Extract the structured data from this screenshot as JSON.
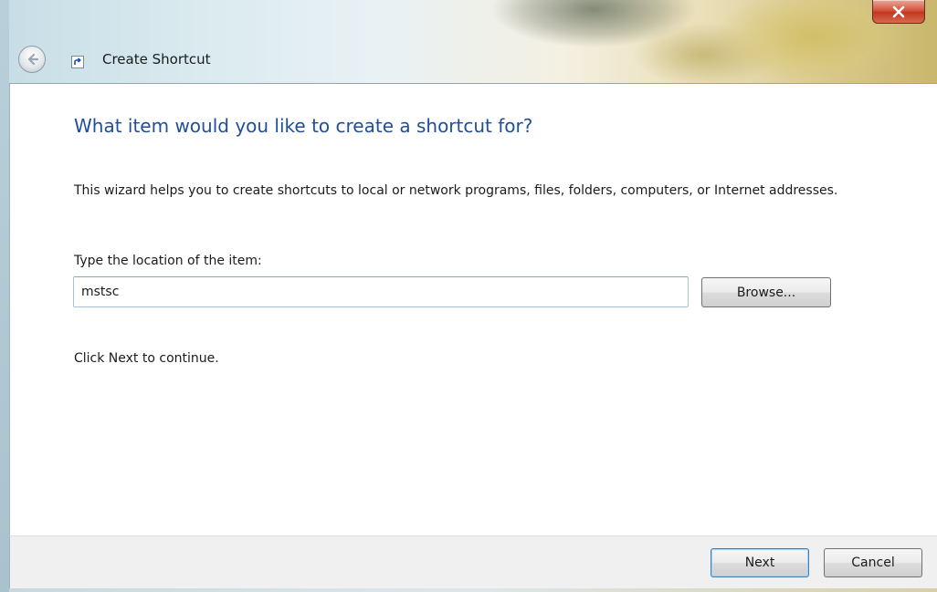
{
  "window": {
    "title": "Create Shortcut"
  },
  "titlebar": {
    "close_icon": "close-x-icon",
    "back_icon": "back-arrow-icon",
    "app_icon": "shortcut-icon"
  },
  "content": {
    "heading": "What item would you like to create a shortcut for?",
    "description": "This wizard helps you to create shortcuts to local or network programs, files, folders, computers, or Internet addresses.",
    "location_label": "Type the location of the item:",
    "location_value": "mstsc",
    "browse_label": "Browse...",
    "continue_text": "Click Next to continue."
  },
  "footer": {
    "next_label": "Next",
    "cancel_label": "Cancel"
  },
  "colors": {
    "heading": "#1f4f9a",
    "close_button": "#c0381f",
    "footer_bg": "#f0f0f0"
  }
}
